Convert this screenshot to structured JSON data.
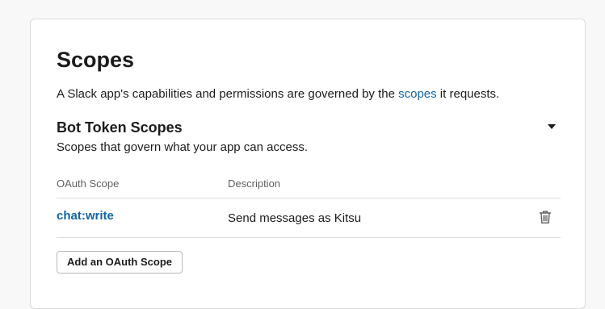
{
  "scopes_section": {
    "title": "Scopes",
    "intro_before": "A Slack app's capabilities and permissions are governed by the ",
    "intro_link": "scopes",
    "intro_after": " it requests."
  },
  "bot_token": {
    "title": "Bot Token Scopes",
    "description": "Scopes that govern what your app can access.",
    "columns": {
      "scope": "OAuth Scope",
      "description": "Description"
    },
    "rows": [
      {
        "scope": "chat:write",
        "description": "Send messages as Kitsu"
      }
    ],
    "add_button": "Add an OAuth Scope"
  },
  "icons": {
    "toggle": "caret-down-icon",
    "remove": "trash-icon"
  }
}
